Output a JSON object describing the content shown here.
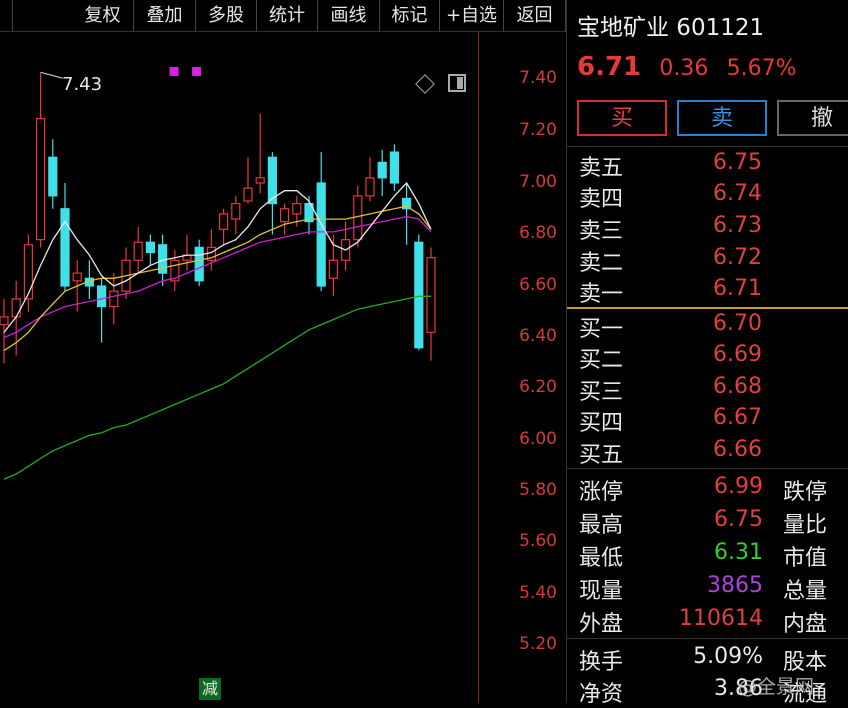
{
  "toolbar": {
    "buttons": [
      "复权",
      "叠加",
      "多股",
      "统计",
      "画线",
      "标记",
      "+自选",
      "返回"
    ]
  },
  "chart": {
    "price_axis_labels": [
      "7.40",
      "7.20",
      "7.00",
      "6.80",
      "6.60",
      "6.40",
      "6.20",
      "6.00",
      "5.80",
      "5.60",
      "5.40",
      "5.20"
    ],
    "peak_label": "7.43",
    "magenta_marker": "▪ ▪",
    "badge": "减",
    "colors": {
      "up": "#e83838",
      "down": "#40e0e8",
      "ma5": "#e8e8e8",
      "ma10": "#e0c030",
      "ma20": "#d020d0",
      "ma60": "#20b020"
    }
  },
  "chart_data": {
    "type": "candlestick",
    "ylim": [
      5.2,
      7.5
    ],
    "y_ticks": [
      7.4,
      7.2,
      7.0,
      6.8,
      6.6,
      6.4,
      6.2,
      6.0,
      5.8,
      5.6,
      5.4,
      5.2
    ],
    "annotation_high": 7.43,
    "candles": [
      {
        "o": 6.45,
        "c": 6.48,
        "h": 6.55,
        "l": 6.3
      },
      {
        "o": 6.48,
        "c": 6.55,
        "h": 6.62,
        "l": 6.33
      },
      {
        "o": 6.55,
        "c": 6.76,
        "h": 6.8,
        "l": 6.5
      },
      {
        "o": 6.78,
        "c": 7.25,
        "h": 7.43,
        "l": 6.75
      },
      {
        "o": 7.1,
        "c": 6.95,
        "h": 7.17,
        "l": 6.9
      },
      {
        "o": 6.9,
        "c": 6.6,
        "h": 7.0,
        "l": 6.58
      },
      {
        "o": 6.62,
        "c": 6.65,
        "h": 6.7,
        "l": 6.5
      },
      {
        "o": 6.63,
        "c": 6.6,
        "h": 6.7,
        "l": 6.55
      },
      {
        "o": 6.6,
        "c": 6.52,
        "h": 6.63,
        "l": 6.38
      },
      {
        "o": 6.52,
        "c": 6.58,
        "h": 6.65,
        "l": 6.45
      },
      {
        "o": 6.58,
        "c": 6.7,
        "h": 6.75,
        "l": 6.55
      },
      {
        "o": 6.7,
        "c": 6.77,
        "h": 6.83,
        "l": 6.65
      },
      {
        "o": 6.77,
        "c": 6.73,
        "h": 6.8,
        "l": 6.68
      },
      {
        "o": 6.76,
        "c": 6.65,
        "h": 6.8,
        "l": 6.6
      },
      {
        "o": 6.62,
        "c": 6.7,
        "h": 6.74,
        "l": 6.58
      },
      {
        "o": 6.7,
        "c": 6.72,
        "h": 6.8,
        "l": 6.66
      },
      {
        "o": 6.75,
        "c": 6.62,
        "h": 6.78,
        "l": 6.6
      },
      {
        "o": 6.7,
        "c": 6.75,
        "h": 6.82,
        "l": 6.66
      },
      {
        "o": 6.82,
        "c": 6.88,
        "h": 6.9,
        "l": 6.76
      },
      {
        "o": 6.86,
        "c": 6.92,
        "h": 6.95,
        "l": 6.8
      },
      {
        "o": 6.93,
        "c": 6.98,
        "h": 7.1,
        "l": 6.92
      },
      {
        "o": 7.0,
        "c": 7.02,
        "h": 7.27,
        "l": 6.96
      },
      {
        "o": 7.1,
        "c": 6.92,
        "h": 7.12,
        "l": 6.8
      },
      {
        "o": 6.85,
        "c": 6.9,
        "h": 6.92,
        "l": 6.8
      },
      {
        "o": 6.88,
        "c": 6.92,
        "h": 6.95,
        "l": 6.83
      },
      {
        "o": 6.92,
        "c": 6.85,
        "h": 6.95,
        "l": 6.8
      },
      {
        "o": 7.0,
        "c": 6.6,
        "h": 7.12,
        "l": 6.58
      },
      {
        "o": 6.63,
        "c": 6.7,
        "h": 6.8,
        "l": 6.56
      },
      {
        "o": 6.7,
        "c": 6.78,
        "h": 6.85,
        "l": 6.66
      },
      {
        "o": 6.78,
        "c": 6.95,
        "h": 6.99,
        "l": 6.75
      },
      {
        "o": 6.95,
        "c": 7.02,
        "h": 7.1,
        "l": 6.93
      },
      {
        "o": 7.08,
        "c": 7.02,
        "h": 7.13,
        "l": 6.95
      },
      {
        "o": 7.12,
        "c": 7.0,
        "h": 7.15,
        "l": 6.97
      },
      {
        "o": 6.94,
        "c": 6.9,
        "h": 7.0,
        "l": 6.76
      },
      {
        "o": 6.77,
        "c": 6.36,
        "h": 6.8,
        "l": 6.35
      },
      {
        "o": 6.42,
        "c": 6.71,
        "h": 6.75,
        "l": 6.31
      }
    ],
    "ma5": [
      6.42,
      6.48,
      6.57,
      6.68,
      6.78,
      6.85,
      6.78,
      6.72,
      6.64,
      6.6,
      6.62,
      6.65,
      6.68,
      6.7,
      6.71,
      6.72,
      6.72,
      6.73,
      6.76,
      6.78,
      6.83,
      6.9,
      6.94,
      6.97,
      6.97,
      6.93,
      6.84,
      6.76,
      6.74,
      6.77,
      6.83,
      6.89,
      6.95,
      7.0,
      6.92,
      6.82
    ],
    "ma10": [
      6.35,
      6.38,
      6.42,
      6.48,
      6.53,
      6.58,
      6.6,
      6.62,
      6.63,
      6.63,
      6.64,
      6.65,
      6.66,
      6.67,
      6.68,
      6.69,
      6.7,
      6.71,
      6.73,
      6.75,
      6.77,
      6.8,
      6.82,
      6.84,
      6.85,
      6.86,
      6.86,
      6.86,
      6.86,
      6.87,
      6.88,
      6.89,
      6.9,
      6.91,
      6.88,
      6.82
    ],
    "ma20": [
      6.4,
      6.42,
      6.45,
      6.48,
      6.5,
      6.52,
      6.53,
      6.54,
      6.55,
      6.56,
      6.57,
      6.58,
      6.6,
      6.62,
      6.63,
      6.65,
      6.67,
      6.69,
      6.71,
      6.73,
      6.75,
      6.77,
      6.78,
      6.79,
      6.8,
      6.81,
      6.81,
      6.81,
      6.82,
      6.83,
      6.84,
      6.85,
      6.86,
      6.87,
      6.86,
      6.81
    ],
    "ma60": [
      5.85,
      5.87,
      5.9,
      5.93,
      5.96,
      5.98,
      6.0,
      6.02,
      6.03,
      6.05,
      6.06,
      6.08,
      6.1,
      6.12,
      6.14,
      6.16,
      6.18,
      6.2,
      6.22,
      6.25,
      6.28,
      6.31,
      6.34,
      6.37,
      6.4,
      6.43,
      6.45,
      6.47,
      6.49,
      6.51,
      6.52,
      6.53,
      6.54,
      6.55,
      6.56,
      6.56
    ]
  },
  "quote": {
    "name_code": "宝地矿业 601121",
    "last_price": "6.71",
    "change": "0.36",
    "change_pct": "5.67%",
    "buttons": {
      "buy": "买",
      "sell": "卖",
      "cancel": "撤"
    },
    "asks": [
      {
        "label": "卖五",
        "price": "6.75"
      },
      {
        "label": "卖四",
        "price": "6.74"
      },
      {
        "label": "卖三",
        "price": "6.73"
      },
      {
        "label": "卖二",
        "price": "6.72"
      },
      {
        "label": "卖一",
        "price": "6.71"
      }
    ],
    "bids": [
      {
        "label": "买一",
        "price": "6.70"
      },
      {
        "label": "买二",
        "price": "6.69"
      },
      {
        "label": "买三",
        "price": "6.68"
      },
      {
        "label": "买四",
        "price": "6.67"
      },
      {
        "label": "买五",
        "price": "6.66"
      }
    ],
    "stats": [
      {
        "label": "涨停",
        "value": "6.99",
        "color": "red",
        "rlabel": "跌停"
      },
      {
        "label": "最高",
        "value": "6.75",
        "color": "red",
        "rlabel": "量比"
      },
      {
        "label": "最低",
        "value": "6.31",
        "color": "green",
        "rlabel": "市值"
      },
      {
        "label": "现量",
        "value": "3865",
        "color": "purple",
        "rlabel": "总量"
      },
      {
        "label": "外盘",
        "value": "110614",
        "color": "red",
        "rlabel": "内盘"
      }
    ],
    "stats2": [
      {
        "label": "换手",
        "value": "5.09%",
        "color": "white",
        "rlabel": "股本"
      },
      {
        "label": "净资",
        "value": "3.86",
        "color": "white",
        "rlabel": "流通"
      }
    ]
  },
  "watermark": "@全景网"
}
